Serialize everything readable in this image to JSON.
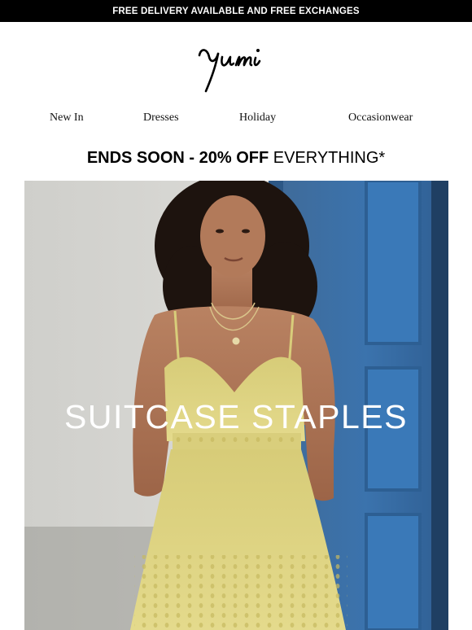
{
  "topbar": {
    "text": "FREE DELIVERY AVAILABLE AND FREE EXCHANGES"
  },
  "brand": {
    "logo_text": "Yumi"
  },
  "nav": {
    "items": [
      {
        "label": "New In"
      },
      {
        "label": "Dresses"
      },
      {
        "label": "Holiday"
      },
      {
        "label": "Occasionwear"
      }
    ]
  },
  "promo": {
    "bold_text": "ENDS SOON - 20% OFF",
    "regular_text": " EVERYTHING*"
  },
  "hero": {
    "title": "SUITCASE STAPLES",
    "image_subject": "woman in yellow broderie sundress by blue door"
  },
  "colors": {
    "topbar_bg": "#000000",
    "topbar_text": "#ffffff",
    "page_bg": "#ffffff",
    "door_blue": "#3b6fa6",
    "dress_yellow": "#ded381"
  }
}
